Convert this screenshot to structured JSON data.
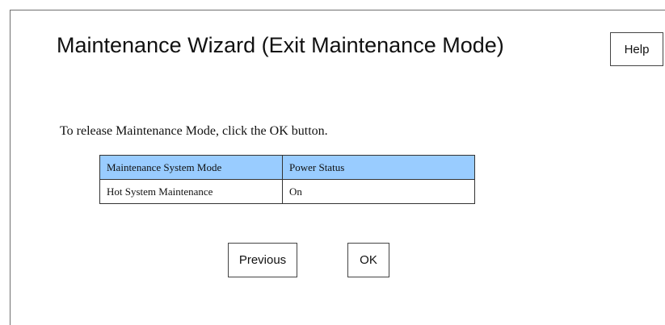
{
  "header": {
    "title": "Maintenance Wizard (Exit Maintenance Mode)",
    "help_label": "Help"
  },
  "main": {
    "instruction": "To release Maintenance Mode, click the OK button.",
    "table": {
      "columns": [
        "Maintenance System Mode",
        "Power Status"
      ],
      "rows": [
        [
          "Hot System Maintenance",
          "On"
        ]
      ]
    }
  },
  "footer": {
    "previous_label": "Previous",
    "ok_label": "OK"
  },
  "colors": {
    "table_header_bg": "#99ccff",
    "frame_border": "#707070"
  }
}
